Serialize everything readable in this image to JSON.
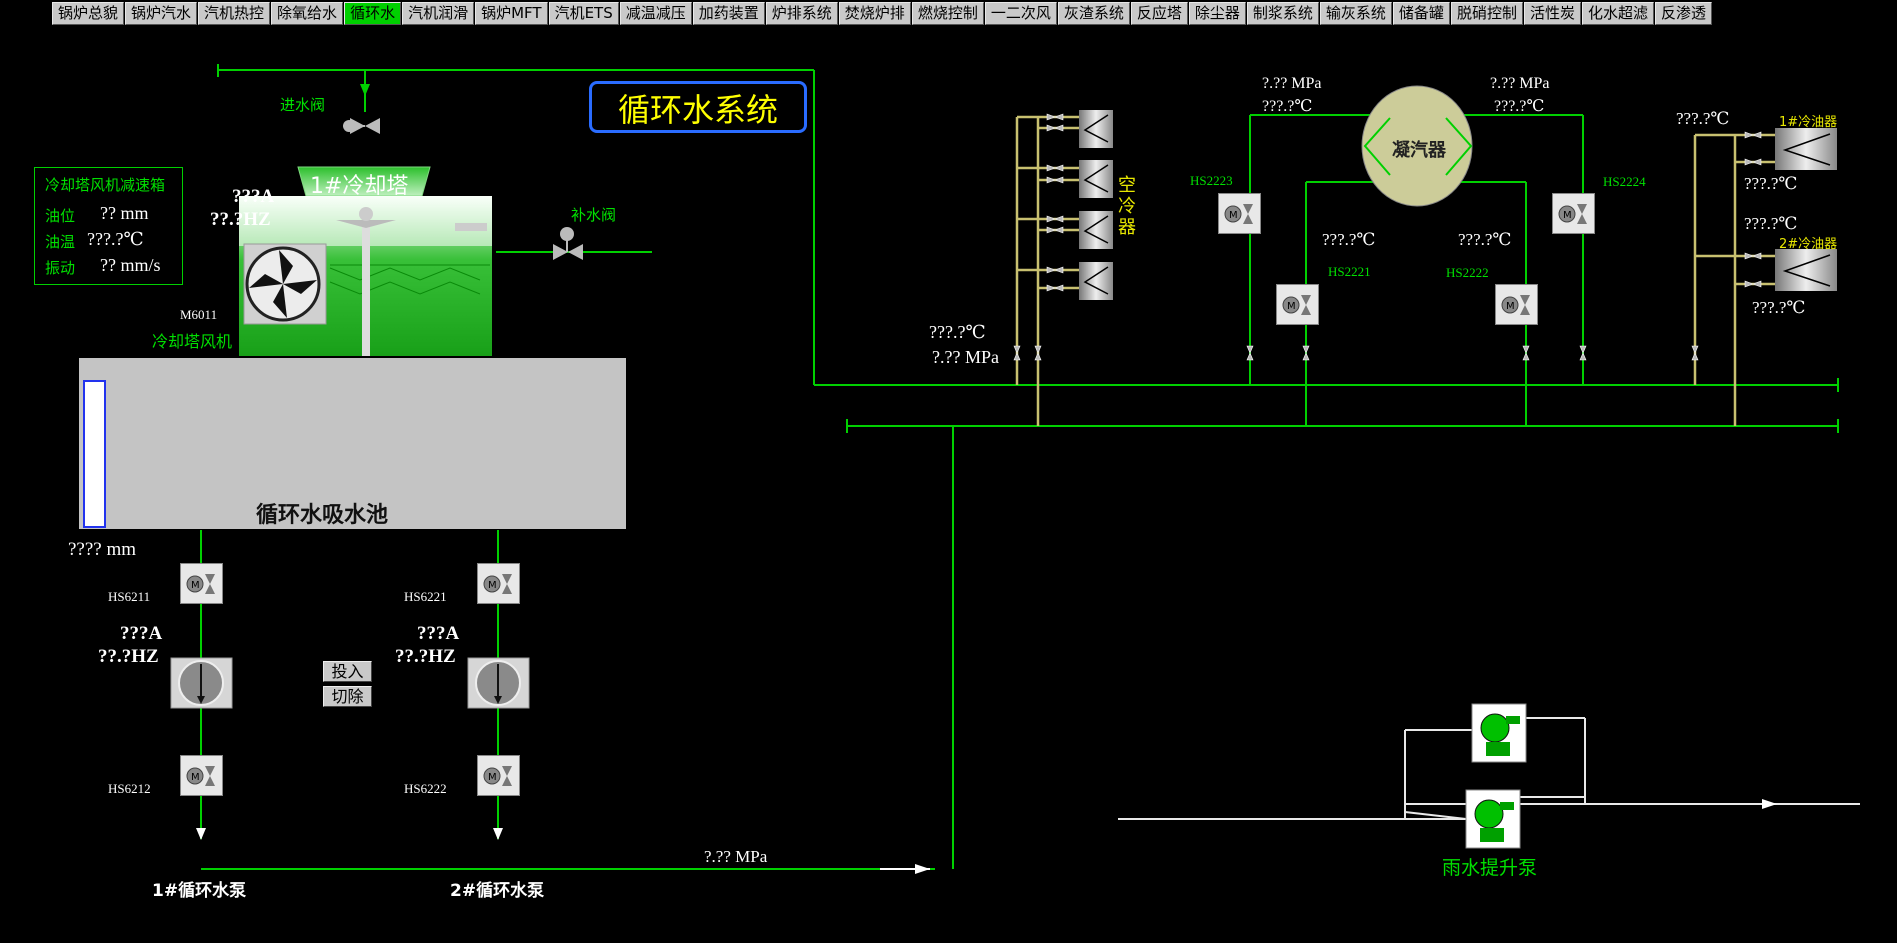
{
  "nav": {
    "tabs": [
      "锅炉总貌",
      "锅炉汽水",
      "汽机热控",
      "除氧给水",
      "循环水",
      "汽机润滑",
      "锅炉MFT",
      "汽机ETS",
      "减温减压",
      "加药装置",
      "炉排系统",
      "焚烧炉排",
      "燃烧控制",
      "一二次风",
      "灰渣系统",
      "反应塔",
      "除尘器",
      "制浆系统",
      "输灰系统",
      "储备罐",
      "脱硝控制",
      "活性炭",
      "化水超滤",
      "反渗透"
    ],
    "active": "循环水"
  },
  "title": "循环水系统",
  "cooling_tower": {
    "label": "1#冷却塔",
    "current": "???A",
    "freq": "??.?HZ",
    "inlet_valve": "进水阀",
    "makeup_valve": "补水阀",
    "fan_tag": "M6011",
    "fan_label": "冷却塔风机"
  },
  "gearbox": {
    "title": "冷却塔风机减速箱",
    "rows": [
      {
        "label": "油位",
        "value": "??  mm"
      },
      {
        "label": "油温",
        "value": "???.?℃"
      },
      {
        "label": "振动",
        "value": "?? mm/s"
      }
    ]
  },
  "pool": {
    "label": "循环水吸水池",
    "level": "???? mm"
  },
  "pumps": [
    {
      "inlet_tag": "HS6211",
      "current": "???A",
      "freq": "??.?HZ",
      "outlet_tag": "HS6212",
      "label": "1#循环水泵"
    },
    {
      "inlet_tag": "HS6221",
      "current": "???A",
      "freq": "??.?HZ",
      "outlet_tag": "HS6222",
      "label": "2#循环水泵"
    }
  ],
  "buttons": {
    "on": "投入",
    "off": "切除"
  },
  "header_pressure": "?.?? MPa",
  "air_cooler": {
    "label": "空冷器",
    "temp": "???.?℃",
    "pressure": "?.?? MPa"
  },
  "condenser": {
    "label": "凝汽器",
    "in_pressure": "?.?? MPa",
    "in_temp": "???.?℃",
    "out_pressure": "?.?? MPa",
    "out_temp": "???.?℃",
    "left_temp": "???.?℃",
    "right_temp": "???.?℃",
    "valves": {
      "hs2223": "HS2223",
      "hs2224": "HS2224",
      "hs2221": "HS2221",
      "hs2222": "HS2222"
    }
  },
  "oil_coolers": [
    {
      "label": "1#冷油器",
      "in_temp": "???.?℃",
      "out_temp": "???.?℃"
    },
    {
      "label": "2#冷油器",
      "in_temp": "???.?℃",
      "out_temp": "???.?℃"
    }
  ],
  "rain_pump": {
    "label": "雨水提升泵"
  },
  "colors": {
    "pipe_green": "#00d000",
    "pipe_yellow": "#c8c070",
    "active_tab": "#00d000",
    "title": "#ffff00"
  }
}
